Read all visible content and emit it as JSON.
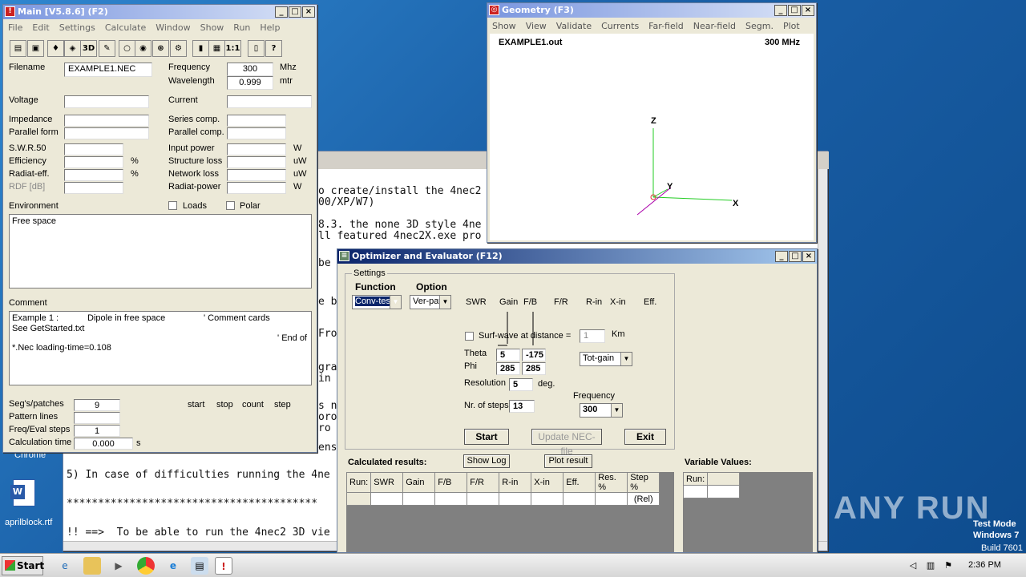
{
  "main": {
    "title": "Main [V5.8.6]  (F2)",
    "menu": [
      "File",
      "Edit",
      "Settings",
      "Calculate",
      "Window",
      "Show",
      "Run",
      "Help"
    ],
    "toolbar": [
      {
        "icon": "open-folder-icon",
        "glyph": "▤"
      },
      {
        "icon": "save-icon",
        "glyph": "▣"
      },
      {
        "icon": "geometry-icon",
        "glyph": "♦"
      },
      {
        "icon": "cube-icon",
        "glyph": "◈"
      },
      {
        "icon": "3d-icon",
        "glyph": "3D"
      },
      {
        "icon": "edit-icon",
        "glyph": "✎"
      },
      {
        "icon": "disabled-icon",
        "glyph": "○"
      },
      {
        "icon": "pattern-icon",
        "glyph": "◉"
      },
      {
        "icon": "target-icon",
        "glyph": "⊛"
      },
      {
        "icon": "gear-icon",
        "glyph": "⚙"
      },
      {
        "icon": "battery-icon",
        "glyph": "▮"
      },
      {
        "icon": "calc-icon",
        "glyph": "▦"
      },
      {
        "icon": "ratio-icon",
        "glyph": "1:1"
      },
      {
        "icon": "book-icon",
        "glyph": "▯"
      },
      {
        "icon": "help-icon",
        "glyph": "?"
      }
    ],
    "filename_label": "Filename",
    "filename": "EXAMPLE1.NEC",
    "frequency_label": "Frequency",
    "frequency": "300",
    "frequency_unit": "Mhz",
    "wavelength_label": "Wavelength",
    "wavelength": "0.999",
    "wavelength_unit": "mtr",
    "voltage_label": "Voltage",
    "current_label": "Current",
    "impedance_label": "Impedance",
    "series_label": "Series comp.",
    "parallel_form_label": "Parallel form",
    "parallel_comp_label": "Parallel comp.",
    "swr_label": "S.W.R.50",
    "input_power_label": "Input power",
    "input_power_unit": "W",
    "efficiency_label": "Efficiency",
    "efficiency_unit": "%",
    "structure_loss_label": "Structure loss",
    "structure_loss_unit": "uW",
    "radiat_eff_label": "Radiat-eff.",
    "radiat_eff_unit": "%",
    "network_loss_label": "Network loss",
    "network_loss_unit": "uW",
    "rdf_label": "RDF [dB]",
    "radiat_power_label": "Radiat-power",
    "radiat_power_unit": "W",
    "environment_label": "Environment",
    "loads_label": "Loads",
    "polar_label": "Polar",
    "environment_text": "Free space",
    "comment_label": "Comment",
    "comment_line1a": "Example 1 :",
    "comment_line1b": "Dipole in free space",
    "comment_line1c": "' Comment cards",
    "comment_line2": "See GetStarted.txt",
    "comment_line3": "' End of",
    "comment_line4": "*.Nec loading-time=0.108",
    "segs_label": "Seg's/patches",
    "segs": "9",
    "pattern_label": "Pattern lines",
    "freq_eval_label": "Freq/Eval steps",
    "freq_eval": "1",
    "calc_time_label": "Calculation time",
    "calc_time": "0.000",
    "calc_time_unit": "s",
    "start_label": "start",
    "stop_label": "stop",
    "count_label": "count",
    "step_label": "step"
  },
  "geometry": {
    "title": "Geometry  (F3)",
    "menu": [
      "Show",
      "View",
      "Validate",
      "Currents",
      "Far-field",
      "Near-field",
      "Segm.",
      "Plot"
    ],
    "file": "EXAMPLE1.out",
    "freq": "300 MHz",
    "axis_z": "Z",
    "axis_y": "Y",
    "axis_x": "X"
  },
  "textwin": {
    "lines": [
      "o create/install the 4nec2",
      "00/XP/W7)",
      "",
      "8.3. the none 3D style 4ne",
      "ll featured 4nec2X.exe pro",
      "",
      "be",
      "",
      "e b",
      "",
      "Fro",
      "",
      "gra",
      "in",
      "",
      "s n",
      "oro",
      "ro",
      "",
      "ens",
      "",
      "5) In case of difficulties running the 4ne",
      "",
      "****************************************",
      "",
      "!! ==>  To be able to run the 4nec2 3D vie"
    ]
  },
  "optimizer": {
    "title": "Optimizer and Evaluator  (F12)",
    "settings_label": "Settings",
    "function_label": "Function",
    "option_label": "Option",
    "function_value": "Conv-test",
    "option_value": "Ver-pat",
    "cols": [
      "SWR",
      "Gain",
      "F/B",
      "F/R",
      "R-in",
      "X-in",
      "Eff."
    ],
    "surfwave_label": "Surf-wave at distance =",
    "surfwave_value": "1",
    "km_label": "Km",
    "theta_label": "Theta",
    "phi_label": "Phi",
    "theta1": "5",
    "theta2": "-175",
    "phi1": "285",
    "phi2": "285",
    "totgain": "Tot-gain",
    "resolution_label": "Resolution",
    "resolution": "5",
    "deg_label": "deg.",
    "frequency_label": "Frequency",
    "frequency": "300",
    "steps_label": "Nr. of steps",
    "steps": "13",
    "start_btn": "Start",
    "update_btn": "Update NEC-file",
    "exit_btn": "Exit",
    "results_label": "Calculated results:",
    "showlog_btn": "Show Log",
    "plot_btn": "Plot result",
    "results_headers": [
      "Run:",
      "SWR",
      "Gain",
      "F/B",
      "F/R",
      "R-in",
      "X-in",
      "Eff.",
      "Res. %",
      "Step %"
    ],
    "results_rel": "(Rel)",
    "variables_label": "Variable Values:",
    "var_header": "Run:"
  },
  "desktop": {
    "chrome_label": "Chrome",
    "file_label": "aprilblock.rtf",
    "watermark": "ANY RUN",
    "testmode1": "Test Mode",
    "testmode2": "Windows 7",
    "testmode3": "Build 7601"
  },
  "taskbar": {
    "start": "Start",
    "clock": "2:36 PM"
  }
}
